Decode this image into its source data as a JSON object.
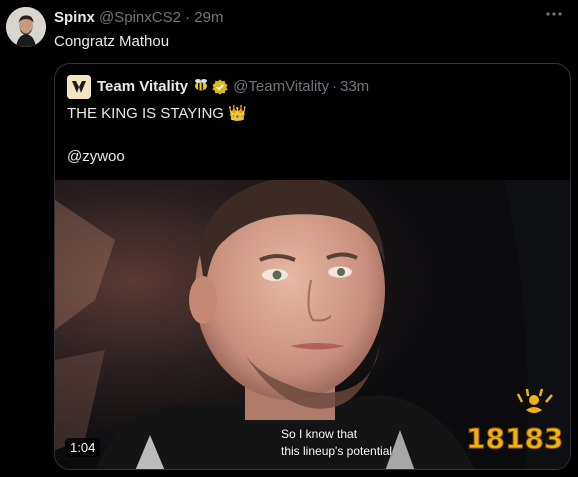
{
  "tweet": {
    "author_name": "Spinx",
    "author_handle": "@SpinxCS2",
    "separator": "·",
    "time": "29m",
    "more_icon": "more-horizontal-icon",
    "text": "Congratz Mathou"
  },
  "quote": {
    "author_name": "Team Vitality",
    "author_handle": "@TeamVitality",
    "separator": "·",
    "time": "33m",
    "line1": "THE KING IS STAYING 👑",
    "line2": "@zywoo",
    "media": {
      "duration": "1:04",
      "subtitle_line1": "So I know that",
      "subtitle_line2": "this lineup's potential",
      "watermark": "18183"
    }
  },
  "colors": {
    "background": "#000000",
    "text_primary": "#e7e9ea",
    "text_muted": "#71767b",
    "border": "#2f3336",
    "verified_gold": "#e2b719",
    "watermark_gold": "#f2b10f"
  }
}
